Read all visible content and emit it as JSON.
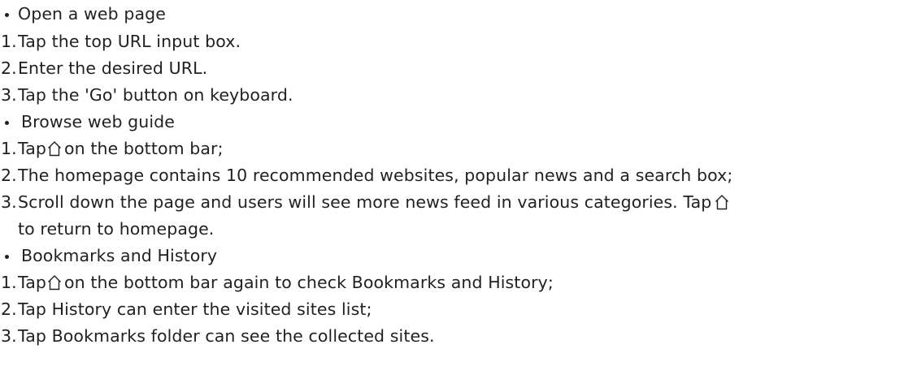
{
  "sections": [
    {
      "heading": "Open a web page",
      "steps": [
        "1.",
        "Tap the top URL input box.",
        "2.",
        "Enter the desired URL.",
        "3.",
        "Tap the 'Go' button on keyboard."
      ]
    },
    {
      "heading": "Browse web guide",
      "step1_num": "1.",
      "step1_a": "Tap",
      "step1_b": "on the bottom bar;",
      "step2_num": "2.",
      "step2": "The homepage contains 10 recommended websites, popular news and a search box;",
      "step3_num": "3.",
      "step3_a": "Scroll down the page and users will see more news feed in various categories. Tap",
      "step3_b": "to return to homepage."
    },
    {
      "heading": "Bookmarks and History",
      "step1_num": "1.",
      "step1_a": "Tap",
      "step1_b": "on the bottom bar again to check Bookmarks and History;",
      "step2_num": "2.",
      "step2": "Tap History can enter the visited sites list;",
      "step3_num": "3.",
      "step3": "Tap Bookmarks folder can see the collected sites."
    }
  ],
  "icons": {
    "home": "home-icon"
  }
}
